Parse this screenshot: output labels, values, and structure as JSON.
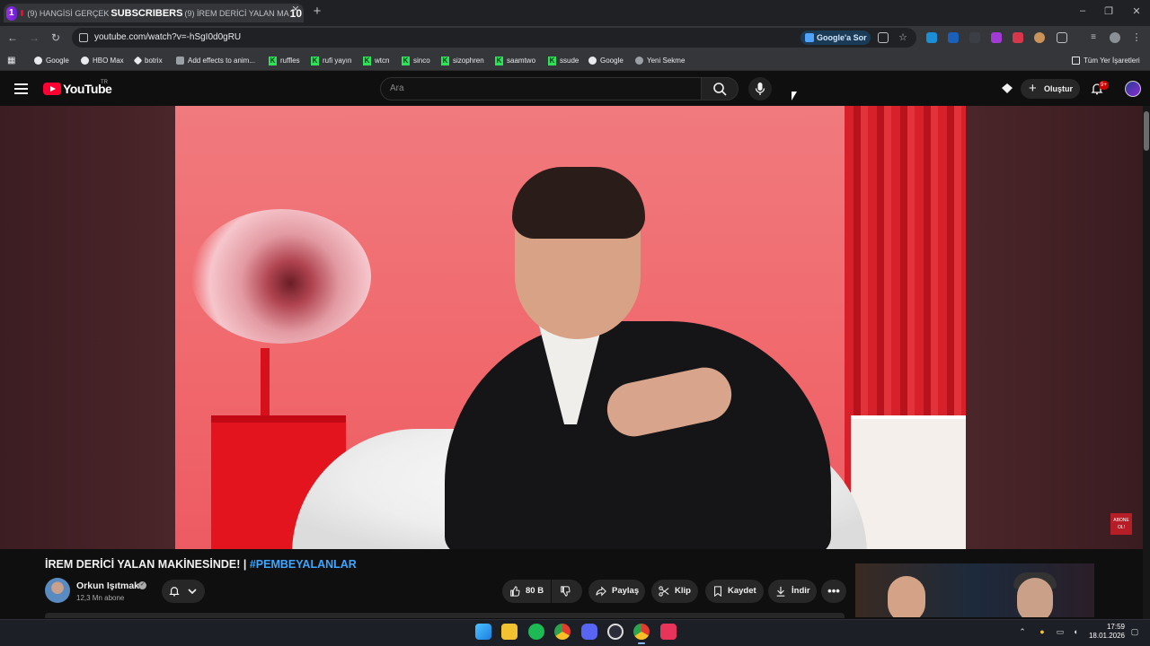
{
  "browser": {
    "tab": {
      "badge": "1",
      "prefix": "(9) HANGİSİ GERÇEK",
      "overlay_big": "SUBSCRIBERS",
      "suffix": "(9) İREM DERİCİ YALAN MA",
      "overlay_num": "10"
    },
    "url": "youtube.com/watch?v=-hSgI0d0gRU",
    "google_sor": "Google'a Sor",
    "bookmarks": [
      {
        "label": "Google",
        "icon": "google-icon"
      },
      {
        "label": "HBO Max",
        "icon": "hbo-icon"
      },
      {
        "label": "botrix",
        "icon": "botrix-icon"
      },
      {
        "label": "Add effects to anim...",
        "icon": "effects-icon"
      },
      {
        "label": "ruffles",
        "icon": "kick-icon"
      },
      {
        "label": "rufi yayın",
        "icon": "kick-icon"
      },
      {
        "label": "wtcn",
        "icon": "kick-icon"
      },
      {
        "label": "sinco",
        "icon": "kick-icon"
      },
      {
        "label": "sizophren",
        "icon": "kick-icon"
      },
      {
        "label": "saamtwo",
        "icon": "kick-icon"
      },
      {
        "label": "ssude",
        "icon": "kick-icon"
      },
      {
        "label": "Google",
        "icon": "google-icon"
      },
      {
        "label": "Yeni Sekme",
        "icon": "globe-icon"
      }
    ],
    "all_bookmarks": "Tüm Yer İşaretleri"
  },
  "youtube": {
    "logo_text": "YouTube",
    "region": "TR",
    "search_placeholder": "Ara",
    "create_label": "Oluştur",
    "notif_count": "9+",
    "video": {
      "title_main": "İREM DERİCİ YALAN MAKİNESİNDE! | ",
      "title_tag": "#PEMBEYALANLAR",
      "channel": "Orkun Işıtmak",
      "subscribers": "12,3 Mn abone",
      "likes": "80 B",
      "share": "Paylaş",
      "clip": "Klip",
      "save": "Kaydet",
      "download": "İndir",
      "abone_badge": "ABONE OL!"
    }
  },
  "taskbar": {
    "time": "17:59",
    "date": "18.01.2026"
  },
  "colors": {
    "accent_link": "#3ea6ff",
    "yt_red": "#ff0033"
  }
}
